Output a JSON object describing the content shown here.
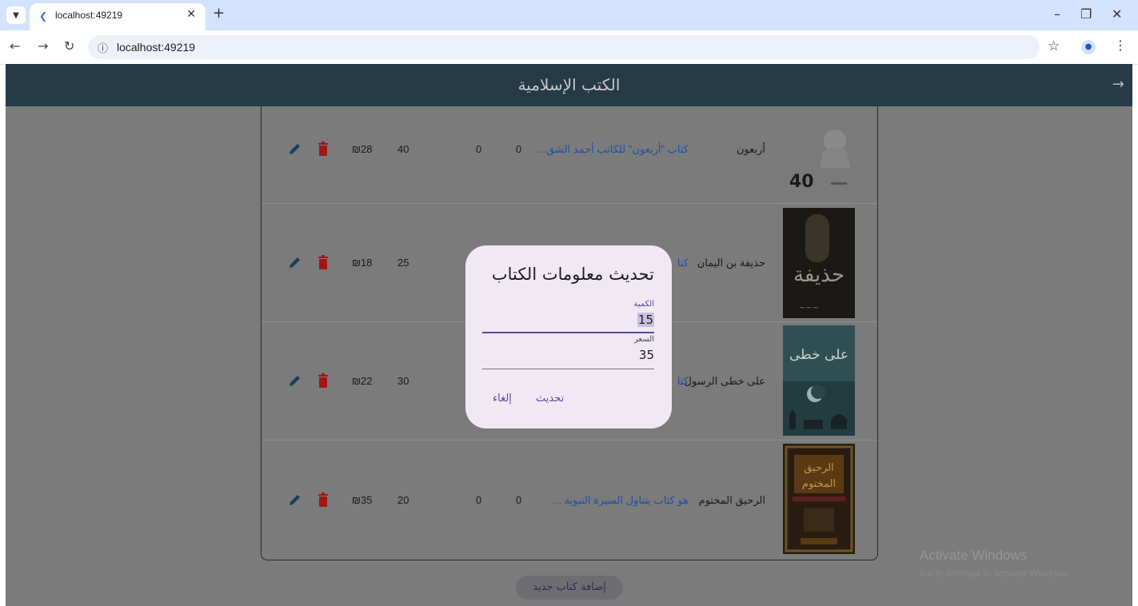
{
  "browser": {
    "tab_title": "localhost:49219",
    "url": "localhost:49219"
  },
  "app": {
    "title": "الكتب الإسلامية",
    "add_button": "إضافة كتاب جديد",
    "books": [
      {
        "name": "أربعون",
        "description": "كتاب \"أربعون\" للكاتب أحمد الشق...",
        "col_a": "0",
        "col_b": "0",
        "quantity": "40",
        "price": "₪28"
      },
      {
        "name": "حذيفة بن اليمان",
        "description": "كتا",
        "quantity": "25",
        "price": "₪18"
      },
      {
        "name": "على خطى الرسول",
        "description": "كتا",
        "quantity": "30",
        "price": "₪22"
      },
      {
        "name": "الرحيق المختوم",
        "description": "هو كتاب يتناول السيرة النبوية ...",
        "col_a": "0",
        "col_b": "0",
        "quantity": "20",
        "price": "₪35"
      }
    ]
  },
  "dialog": {
    "title": "تحديث معلومات الكتاب",
    "quantity_label": "الكمية",
    "quantity_value": "15",
    "price_label": "السعر",
    "price_value": "35",
    "update_button": "تحديث",
    "cancel_button": "إلغاء"
  },
  "watermark": {
    "line1": "Activate Windows",
    "line2": "Go to Settings to activate Windows."
  },
  "colors": {
    "appbar": "#263a47",
    "scrim": "#7b7b7b",
    "dialog_bg": "#f0e9f4",
    "accent": "#5b47a0",
    "delete": "#a31616"
  }
}
